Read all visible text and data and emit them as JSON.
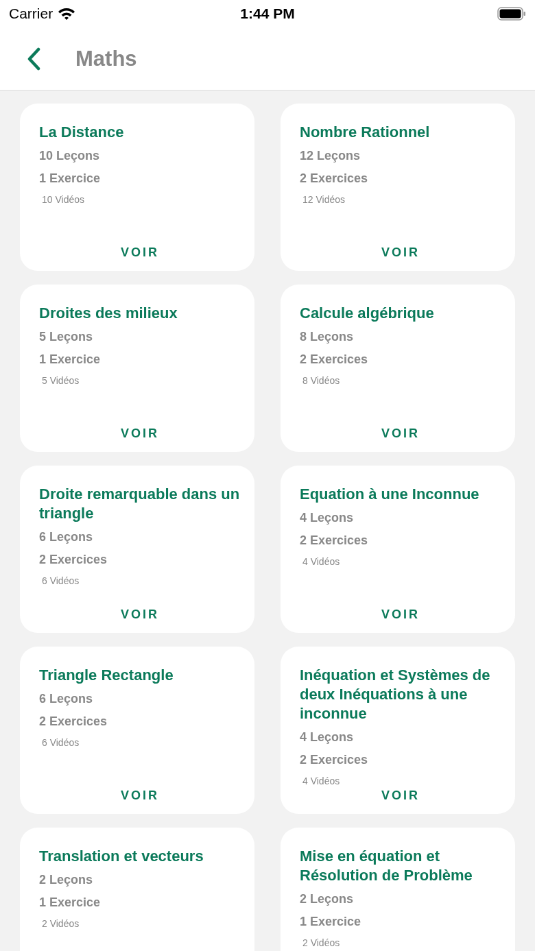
{
  "status_bar": {
    "carrier": "Carrier",
    "time": "1:44 PM"
  },
  "header": {
    "title": "Maths"
  },
  "cards": [
    {
      "title": "La Distance",
      "lessons": "10 Leçons",
      "exercises": "1 Exercice",
      "videos": "10 Vidéos",
      "button": "VOIR"
    },
    {
      "title": "Nombre Rationnel",
      "lessons": "12 Leçons",
      "exercises": "2 Exercices",
      "videos": "12 Vidéos",
      "button": "VOIR"
    },
    {
      "title": "Droites des milieux",
      "lessons": "5 Leçons",
      "exercises": "1 Exercice",
      "videos": "5 Vidéos",
      "button": "VOIR"
    },
    {
      "title": "Calcule algébrique",
      "lessons": "8 Leçons",
      "exercises": "2 Exercices",
      "videos": "8 Vidéos",
      "button": "VOIR"
    },
    {
      "title": "Droite remarquable dans un triangle",
      "lessons": "6 Leçons",
      "exercises": "2 Exercices",
      "videos": "6 Vidéos",
      "button": "VOIR"
    },
    {
      "title": "Equation à une Inconnue",
      "lessons": "4 Leçons",
      "exercises": "2 Exercices",
      "videos": "4 Vidéos",
      "button": "VOIR"
    },
    {
      "title": "Triangle Rectangle",
      "lessons": "6 Leçons",
      "exercises": "2 Exercices",
      "videos": "6 Vidéos",
      "button": "VOIR"
    },
    {
      "title": "Inéquation et Systèmes de deux Inéquations à une inconnue",
      "lessons": "4 Leçons",
      "exercises": "2 Exercices",
      "videos": "4 Vidéos",
      "button": "VOIR"
    },
    {
      "title": "Translation et vecteurs",
      "lessons": "2 Leçons",
      "exercises": "1 Exercice",
      "videos": "2 Vidéos"
    },
    {
      "title": "Mise en équation et Résolution de Problème",
      "lessons": "2 Leçons",
      "exercises": "1 Exercice",
      "videos": "2 Vidéos"
    }
  ]
}
